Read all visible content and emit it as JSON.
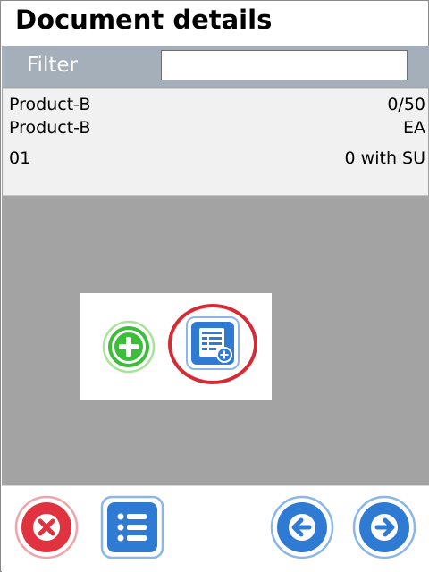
{
  "header": {
    "title": "Document details"
  },
  "filter": {
    "label": "Filter",
    "value": "",
    "placeholder": ""
  },
  "document_items": [
    {
      "product_name": "Product-B",
      "quantity": "0/50",
      "product_description": "Product-B",
      "unit": "EA",
      "code": "01",
      "storage_units": "0 with SU"
    }
  ],
  "popup": {
    "buttons": [
      {
        "icon": "plus-circle-icon",
        "color": "#3dbe3a"
      },
      {
        "icon": "document-add-icon",
        "color": "#2f7bd4",
        "highlighted": true
      }
    ],
    "highlight_color": "#d52b35"
  },
  "toolbar": {
    "buttons": [
      {
        "icon": "close-icon",
        "color": "#e0333f"
      },
      {
        "icon": "list-icon",
        "color": "#2f7bd4"
      },
      {
        "icon": "arrow-left-icon",
        "color": "#2f7bd4"
      },
      {
        "icon": "arrow-right-icon",
        "color": "#2f7bd4"
      }
    ]
  },
  "colors": {
    "filter_bar": "#a4afb9",
    "list_background": "#a3a3a3",
    "item_background": "#f1f1f1"
  }
}
